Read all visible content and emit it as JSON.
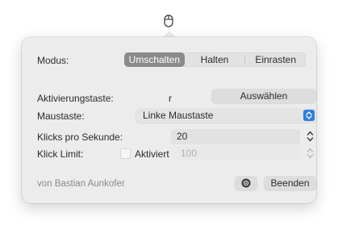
{
  "menubar": {
    "icon": "mouse-icon"
  },
  "modus": {
    "label": "Modus:",
    "options": [
      "Umschalten",
      "Halten",
      "Einrasten"
    ],
    "selected": "Umschalten"
  },
  "activation": {
    "label": "Aktivierungstaste:",
    "key": "r",
    "button_label": "Auswählen"
  },
  "mouse_button": {
    "label": "Maustaste:",
    "value": "Linke Maustaste"
  },
  "clicks_per_second": {
    "label": "Klicks pro Sekunde:",
    "value": "20"
  },
  "click_limit": {
    "label": "Klick Limit:",
    "checkbox_label": "Aktiviert",
    "checked": false,
    "value": "100"
  },
  "footer": {
    "author": "von Bastian Aunkofer",
    "quit_label": "Beenden",
    "settings_icon": "gear-icon"
  },
  "colors": {
    "selected_segment": "#8a8a8a",
    "popup_accent": "#2a7de1",
    "popover_bg": "#ececec"
  }
}
